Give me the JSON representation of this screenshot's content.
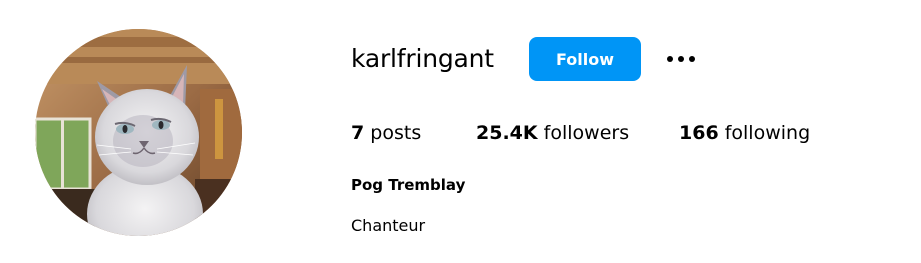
{
  "profile": {
    "username": "karlfringant",
    "follow_label": "Follow",
    "more_label": "More options",
    "avatar_alt": "cat-profile-photo",
    "stats": {
      "posts_count": "7",
      "posts_label": "posts",
      "followers_count": "25.4K",
      "followers_label": "followers",
      "following_count": "166",
      "following_label": "following"
    },
    "full_name": "Pog Tremblay",
    "bio": "Chanteur"
  },
  "colors": {
    "accent": "#0095f6",
    "text": "#000000",
    "background": "#ffffff"
  },
  "icons": {
    "more": "more-horizontal-icon"
  }
}
